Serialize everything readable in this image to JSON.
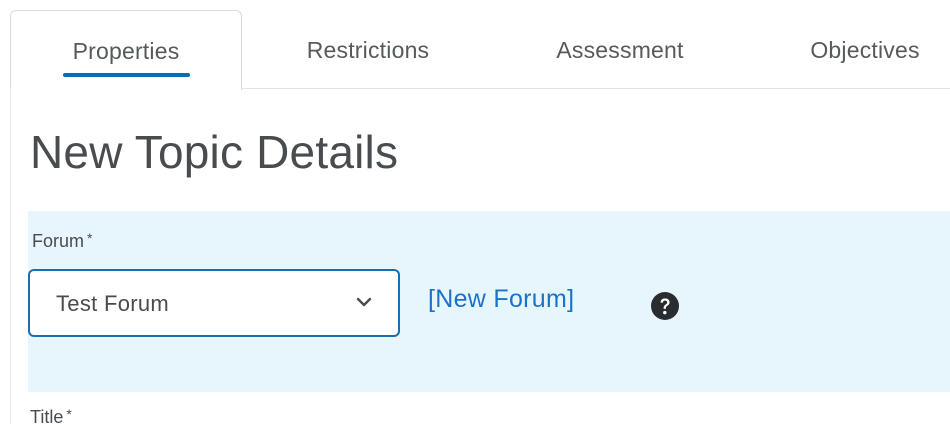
{
  "tabs": [
    {
      "label": "Properties",
      "active": true
    },
    {
      "label": "Restrictions",
      "active": false
    },
    {
      "label": "Assessment",
      "active": false
    },
    {
      "label": "Objectives",
      "active": false
    }
  ],
  "page": {
    "title": "New Topic Details"
  },
  "forum": {
    "label": "Forum",
    "required_marker": "*",
    "selected_value": "Test Forum",
    "new_forum_link": "[New Forum]",
    "help_icon": "question-circle-icon",
    "panel_color": "#e7f6fd",
    "accent_color": "#006fbf"
  },
  "title_field": {
    "label": "Title",
    "required_marker": "*"
  }
}
